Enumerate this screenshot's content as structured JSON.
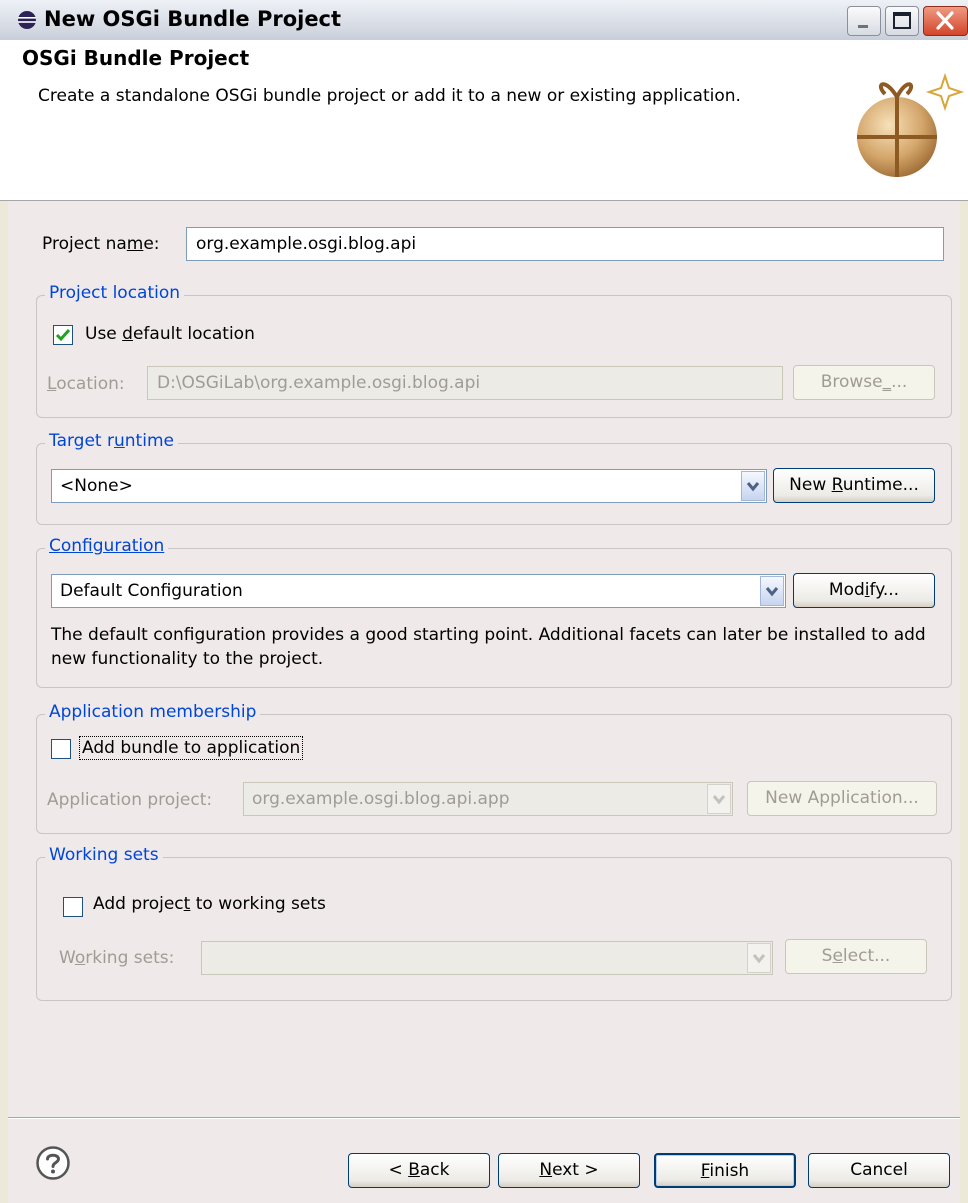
{
  "window": {
    "title": "New OSGi Bundle Project"
  },
  "header": {
    "title": "OSGi Bundle Project",
    "description": "Create a standalone OSGi bundle project or add it to a new or existing application."
  },
  "project_name": {
    "label_pre": "Project na",
    "label_accel": "m",
    "label_post": "e:",
    "value": "org.example.osgi.blog.api"
  },
  "project_location": {
    "legend": "Project location",
    "use_default": {
      "pre": "Use ",
      "accel": "d",
      "post": "efault location",
      "checked": true
    },
    "location_label": {
      "accel": "L",
      "post": "ocation:"
    },
    "location_value": "D:\\OSGiLab\\org.example.osgi.blog.api",
    "browse": {
      "pre": "Browse",
      "accel": "_",
      "post": "..."
    }
  },
  "target_runtime": {
    "legend_pre": "Target r",
    "legend_accel": "u",
    "legend_post": "ntime",
    "value": "<None>",
    "new_runtime": {
      "pre": "New ",
      "accel": "R",
      "post": "untime..."
    }
  },
  "configuration": {
    "legend_accel": "C",
    "legend_post": "onfiguration",
    "value": "Default Configuration",
    "modify": {
      "pre": "Mod",
      "accel": "i",
      "post": "fy..."
    },
    "description": "The default configuration provides a good starting point. Additional facets can later be installed to add new functionality to the project."
  },
  "application_membership": {
    "legend": "Application membership",
    "add_bundle": {
      "label": "Add bundle to application",
      "checked": false
    },
    "project_label": "Application project:",
    "project_value": "org.example.osgi.blog.api.app",
    "new_application": "New Application..."
  },
  "working_sets": {
    "legend": "Working sets",
    "add_project": {
      "pre": "Add projec",
      "accel": "t",
      "post": " to working sets",
      "checked": false
    },
    "label": {
      "pre": "W",
      "accel": "o",
      "post": "rking sets:"
    },
    "value": "",
    "select": {
      "pre": "S",
      "accel": "e",
      "post": "lect..."
    }
  },
  "footer": {
    "back": {
      "pre": "< ",
      "accel": "B",
      "post": "ack"
    },
    "next": {
      "accel": "N",
      "post": "ext >"
    },
    "finish": {
      "accel": "F",
      "post": "inish"
    },
    "cancel": "Cancel"
  },
  "colors": {
    "legend": "#0046d5",
    "accent_close": "#d2452a",
    "check": "#21a121",
    "disabled_text": "#a09c94"
  }
}
